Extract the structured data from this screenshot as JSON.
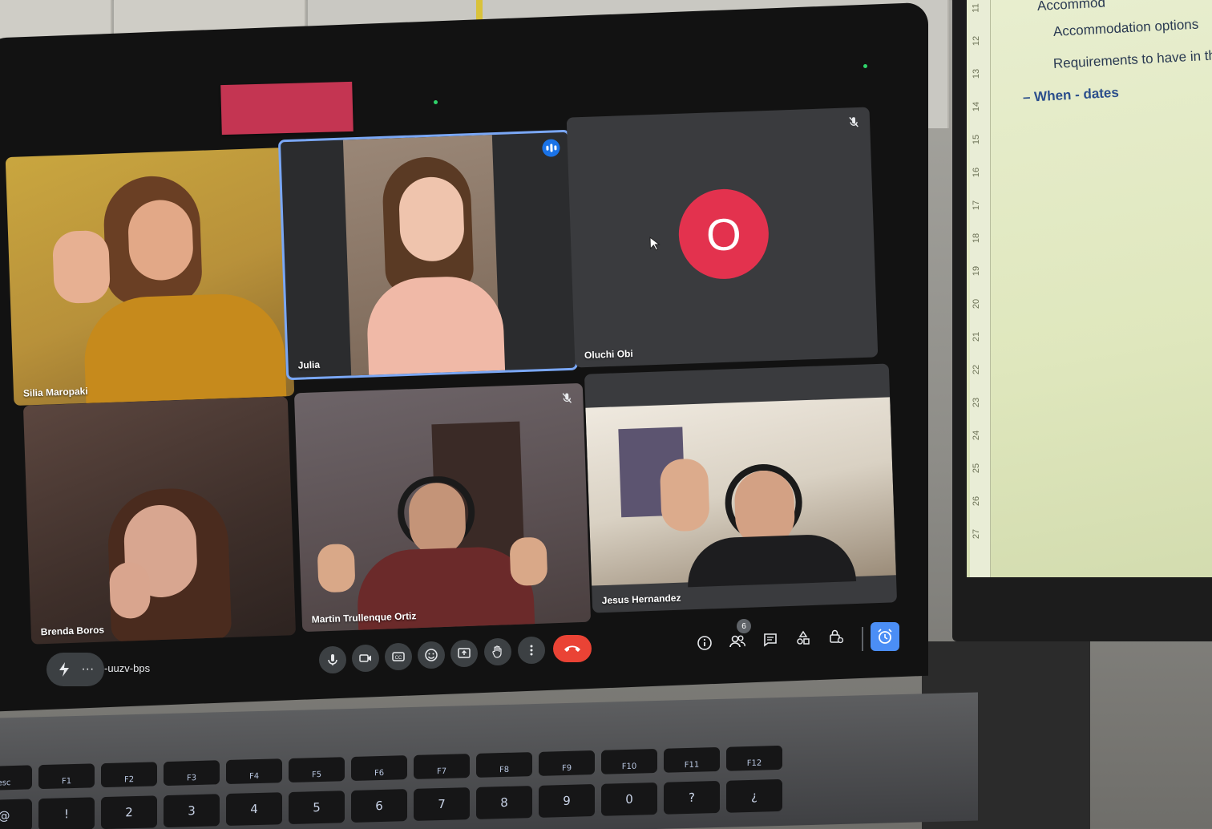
{
  "meeting": {
    "code": "-uuzv-bps",
    "participant_count": "6"
  },
  "participants": [
    {
      "name": "Silia Maropaki",
      "state": "video"
    },
    {
      "name": "Julia",
      "state": "video-speaking"
    },
    {
      "name": "Oluchi Obi",
      "state": "avatar-muted",
      "avatar_letter": "O"
    },
    {
      "name": "Brenda Boros",
      "state": "video"
    },
    {
      "name": "Martin Trullenque Ortiz",
      "state": "video-muted"
    },
    {
      "name": "Jesus Hernandez",
      "state": "video"
    }
  ],
  "toolbar": {
    "buttons": [
      "mic-icon",
      "camera-icon",
      "captions-icon",
      "emoji-icon",
      "present-icon",
      "raise-hand-icon",
      "more-options-icon"
    ],
    "hangup": "hangup-icon",
    "right_icons": [
      "info-icon",
      "people-icon",
      "chat-icon",
      "activities-icon",
      "host-controls-icon",
      "timer-icon"
    ]
  },
  "monitor_doc": {
    "lines": [
      "Accommod",
      "Accommodation options",
      "Requirements to have in th",
      "– When - dates"
    ],
    "ruler_numbers": [
      "11",
      "12",
      "13",
      "14",
      "15",
      "16",
      "17",
      "18",
      "19",
      "20",
      "21",
      "22",
      "23",
      "24",
      "25",
      "26",
      "27"
    ]
  },
  "keyboard": {
    "fn_row": [
      "esc",
      "F1",
      "F2",
      "F3",
      "F4",
      "F5",
      "F6",
      "F7",
      "F8",
      "F9",
      "F10",
      "F11",
      "F12"
    ],
    "num_row": [
      "@",
      "!",
      "2",
      "3",
      "4",
      "5",
      "6",
      "7",
      "8",
      "9",
      "0",
      "?",
      "¿"
    ]
  },
  "colors": {
    "meet_bg": "#202124",
    "tile_bg": "#3c4043",
    "hangup": "#ea4335",
    "avatar": "#e3324e",
    "active_speaker": "#7aa7f5",
    "timer": "#4b8ef5"
  }
}
